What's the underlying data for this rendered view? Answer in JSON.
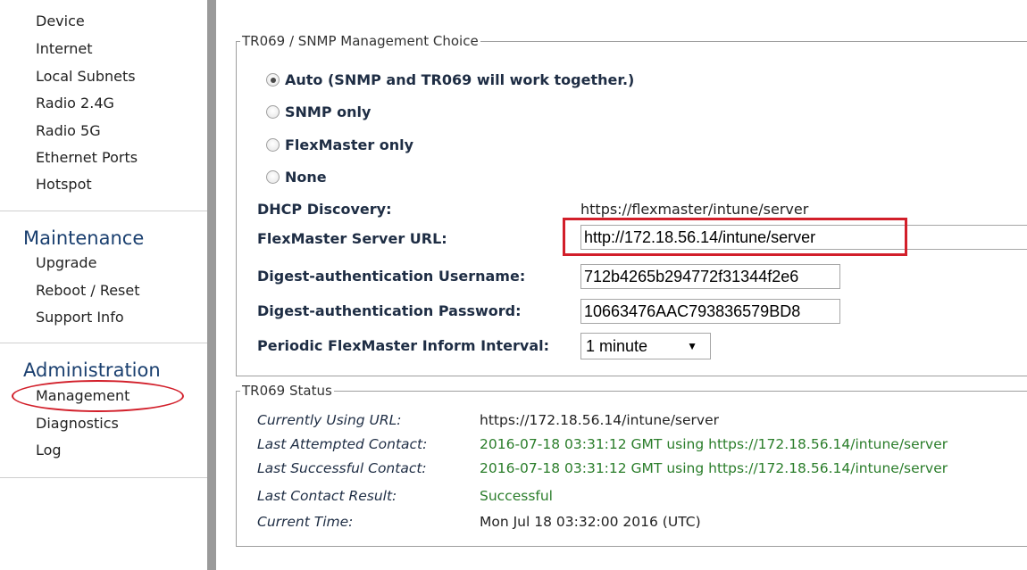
{
  "sidebar": {
    "group1": [
      "Device",
      "Internet",
      "Local Subnets",
      "Radio 2.4G",
      "Radio 5G",
      "Ethernet Ports",
      "Hotspot"
    ],
    "maintenance_title": "Maintenance",
    "maintenance": [
      "Upgrade",
      "Reboot / Reset",
      "Support Info"
    ],
    "administration_title": "Administration",
    "administration": [
      "Management",
      "Diagnostics",
      "Log"
    ],
    "selected_item": "Management"
  },
  "management_choice": {
    "legend": "TR069 / SNMP Management Choice",
    "options": [
      {
        "label": "Auto (SNMP and TR069 will work together.)",
        "checked": true
      },
      {
        "label": "SNMP only",
        "checked": false
      },
      {
        "label": "FlexMaster only",
        "checked": false
      },
      {
        "label": "None",
        "checked": false
      }
    ],
    "dhcp_discovery_label": "DHCP Discovery:",
    "dhcp_discovery_value": "https://flexmaster/intune/server",
    "server_url_label": "FlexMaster Server URL:",
    "server_url_value": "http://172.18.56.14/intune/server",
    "username_label": "Digest-authentication Username:",
    "username_value": "712b4265b294772f31344f2e6",
    "password_label": "Digest-authentication Password:",
    "password_value": "10663476AAC793836579BD8",
    "interval_label": "Periodic FlexMaster Inform Interval:",
    "interval_value": "1 minute"
  },
  "status": {
    "legend": "TR069 Status",
    "rows": [
      {
        "label": "Currently Using URL:",
        "value": "https://172.18.56.14/intune/server",
        "color": "#222222"
      },
      {
        "label": "Last Attempted Contact:",
        "value": "2016-07-18 03:31:12 GMT using https://172.18.56.14/intune/server",
        "color": "#2a7d2a"
      },
      {
        "label": "Last Successful Contact:",
        "value": "2016-07-18 03:31:12 GMT using https://172.18.56.14/intune/server",
        "color": "#2a7d2a"
      },
      {
        "label": "Last Contact Result:",
        "value": "Successful",
        "color": "#2a7d2a"
      },
      {
        "label": "Current Time:",
        "value": "Mon Jul 18 03:32:00 2016 (UTC)",
        "color": "#222222"
      }
    ]
  },
  "colors": {
    "section_title": "#1a3f6f",
    "highlight_red": "#d21f2a",
    "success_green": "#2a7d2a"
  }
}
